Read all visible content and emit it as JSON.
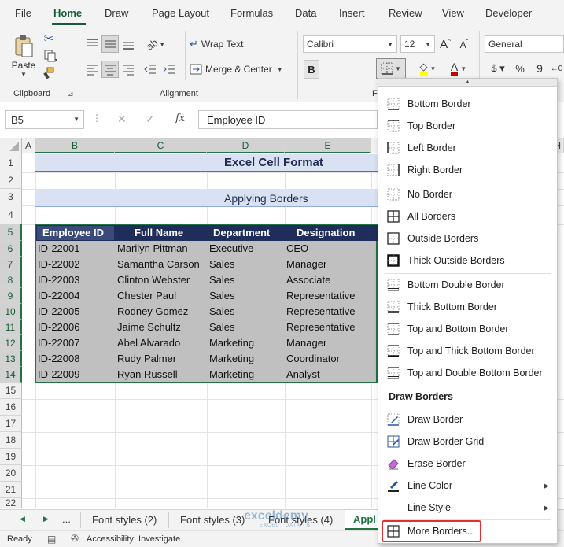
{
  "menu": {
    "tabs": [
      {
        "label": "File"
      },
      {
        "label": "Home"
      },
      {
        "label": "Draw"
      },
      {
        "label": "Page Layout"
      },
      {
        "label": "Formulas"
      },
      {
        "label": "Data"
      },
      {
        "label": "Insert"
      },
      {
        "label": "Review"
      },
      {
        "label": "View"
      },
      {
        "label": "Developer"
      }
    ],
    "active": "Home"
  },
  "ribbon": {
    "clipboard": {
      "paste_label": "Paste",
      "group_label": "Clipboard"
    },
    "alignment": {
      "wrap_text": "Wrap Text",
      "merge_center": "Merge & Center",
      "group_label": "Alignment"
    },
    "font": {
      "name": "Calibri",
      "size": "12",
      "group_label_partial": "F"
    },
    "number": {
      "format": "General"
    },
    "colors": {
      "accent": "#217346",
      "fill_color": "#ffff00",
      "font_color": "#c00000"
    }
  },
  "formula_bar": {
    "name_box": "B5",
    "fx": "fx",
    "content": "Employee ID"
  },
  "grid": {
    "columns": [
      "A",
      "B",
      "C",
      "D",
      "E",
      "H"
    ],
    "rows": [
      "1",
      "2",
      "3",
      "4",
      "5",
      "6",
      "7",
      "8",
      "9",
      "10",
      "11",
      "12",
      "13",
      "14",
      "15",
      "16",
      "17",
      "18",
      "19",
      "20",
      "21",
      "22"
    ],
    "title": "Excel Cell Format",
    "subtitle": "Applying Borders",
    "table": {
      "headers": [
        "Employee ID",
        "Full Name",
        "Department",
        "Designation"
      ],
      "rows": [
        [
          "ID-22001",
          "Marilyn Pittman",
          "Executive",
          "CEO"
        ],
        [
          "ID-22002",
          "Samantha Carson",
          "Sales",
          "Manager"
        ],
        [
          "ID-22003",
          "Clinton Webster",
          "Sales",
          "Associate"
        ],
        [
          "ID-22004",
          "Chester Paul",
          "Sales",
          "Representative"
        ],
        [
          "ID-22005",
          "Rodney Gomez",
          "Sales",
          "Representative"
        ],
        [
          "ID-22006",
          "Jaime Schultz",
          "Sales",
          "Representative"
        ],
        [
          "ID-22007",
          "Abel Alvarado",
          "Marketing",
          "Manager"
        ],
        [
          "ID-22008",
          "Rudy Palmer",
          "Marketing",
          "Coordinator"
        ],
        [
          "ID-22009",
          "Ryan Russell",
          "Marketing",
          "Analyst"
        ]
      ]
    }
  },
  "sheet_tabs": {
    "ellipsis": "...",
    "tabs": [
      {
        "label": "Font styles (2)"
      },
      {
        "label": "Font styles (3)"
      },
      {
        "label": "Font styles (4)"
      },
      {
        "label": "Appl"
      }
    ]
  },
  "status_bar": {
    "ready": "Ready",
    "accessibility": "Accessibility: Investigate"
  },
  "watermark": {
    "name": "exceldemy",
    "tagline": "EXCEL · DATA · BI"
  },
  "borders_menu": {
    "group1": [
      {
        "label": "Bottom Border",
        "icon": "bottom-border-icon"
      },
      {
        "label": "Top Border",
        "icon": "top-border-icon"
      },
      {
        "label": "Left Border",
        "icon": "left-border-icon"
      },
      {
        "label": "Right Border",
        "icon": "right-border-icon"
      }
    ],
    "group2": [
      {
        "label": "No Border",
        "icon": "no-border-icon"
      },
      {
        "label": "All Borders",
        "icon": "all-borders-icon"
      },
      {
        "label": "Outside Borders",
        "icon": "outside-borders-icon"
      },
      {
        "label": "Thick Outside Borders",
        "icon": "thick-outside-borders-icon"
      }
    ],
    "group3": [
      {
        "label": "Bottom Double Border",
        "icon": "bottom-double-border-icon"
      },
      {
        "label": "Thick Bottom Border",
        "icon": "thick-bottom-border-icon"
      },
      {
        "label": "Top and Bottom Border",
        "icon": "top-bottom-border-icon"
      },
      {
        "label": "Top and Thick Bottom Border",
        "icon": "top-thick-bottom-border-icon"
      },
      {
        "label": "Top and Double Bottom Border",
        "icon": "top-double-bottom-border-icon"
      }
    ],
    "draw_heading": "Draw Borders",
    "draw": [
      {
        "label": "Draw Border",
        "icon": "pencil-icon"
      },
      {
        "label": "Draw Border Grid",
        "icon": "grid-pencil-icon"
      },
      {
        "label": "Erase Border",
        "icon": "eraser-icon"
      },
      {
        "label": "Line Color",
        "icon": "line-color-icon"
      },
      {
        "label": "Line Style",
        "icon": ""
      }
    ],
    "more": {
      "label": "More Borders...",
      "icon": "more-borders-icon",
      "highlight_color": "#e03030"
    }
  }
}
